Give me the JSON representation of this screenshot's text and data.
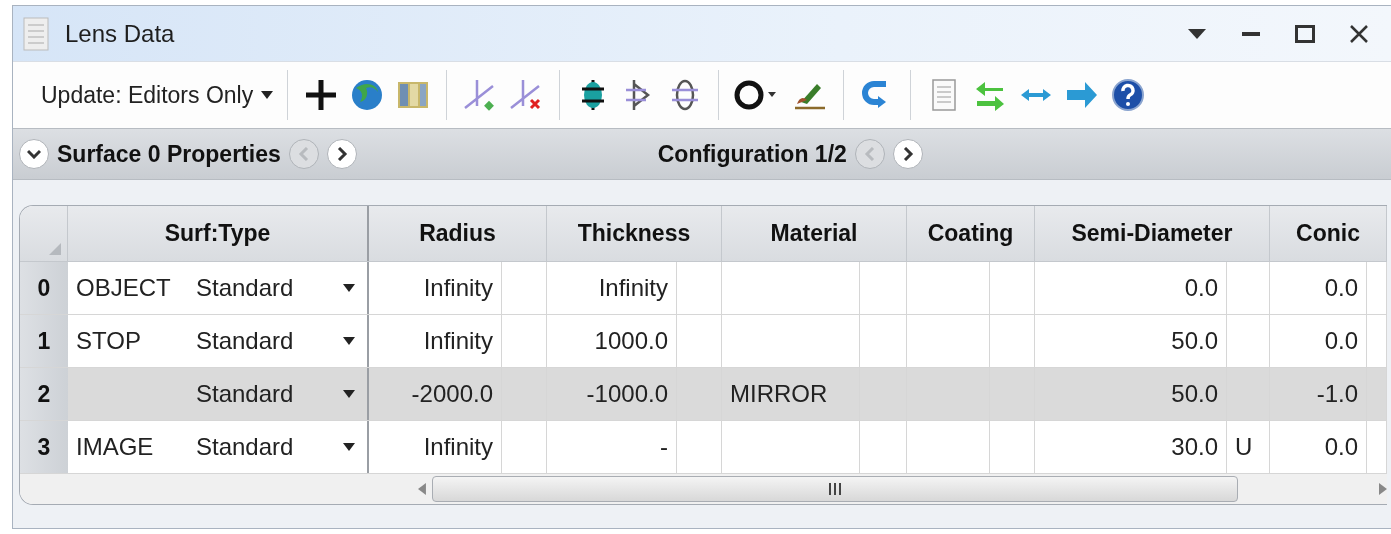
{
  "window": {
    "title": "Lens Data"
  },
  "toolbar": {
    "update_dropdown": "Update: Editors Only"
  },
  "properties_bar": {
    "surface_label": "Surface 0 Properties",
    "configuration_label": "Configuration 1/2"
  },
  "table": {
    "columns": [
      "Surf:Type",
      "Radius",
      "Thickness",
      "Material",
      "Coating",
      "Semi-Diameter",
      "Conic"
    ],
    "rows": [
      {
        "index": "0",
        "comment": "OBJECT",
        "type": "Standard",
        "radius": "Infinity",
        "thickness": "Infinity",
        "semi_diameter": "0.0",
        "conic": "0.0",
        "selected": false
      },
      {
        "index": "1",
        "comment": "STOP",
        "type": "Standard",
        "radius": "Infinity",
        "thickness": "1000.0",
        "semi_diameter": "50.0",
        "conic": "0.0",
        "selected": false
      },
      {
        "index": "2",
        "type": "Standard",
        "radius": "-2000.0",
        "thickness": "-1000.0",
        "material": "MIRROR",
        "semi_diameter": "50.0",
        "conic": "-1.0",
        "selected": true
      },
      {
        "index": "3",
        "comment": "IMAGE",
        "type": "Standard",
        "radius": "Infinity",
        "thickness": "-",
        "semi_diameter": "30.0",
        "semi_diameter_solve": "U",
        "conic": "0.0",
        "selected": false
      }
    ]
  }
}
